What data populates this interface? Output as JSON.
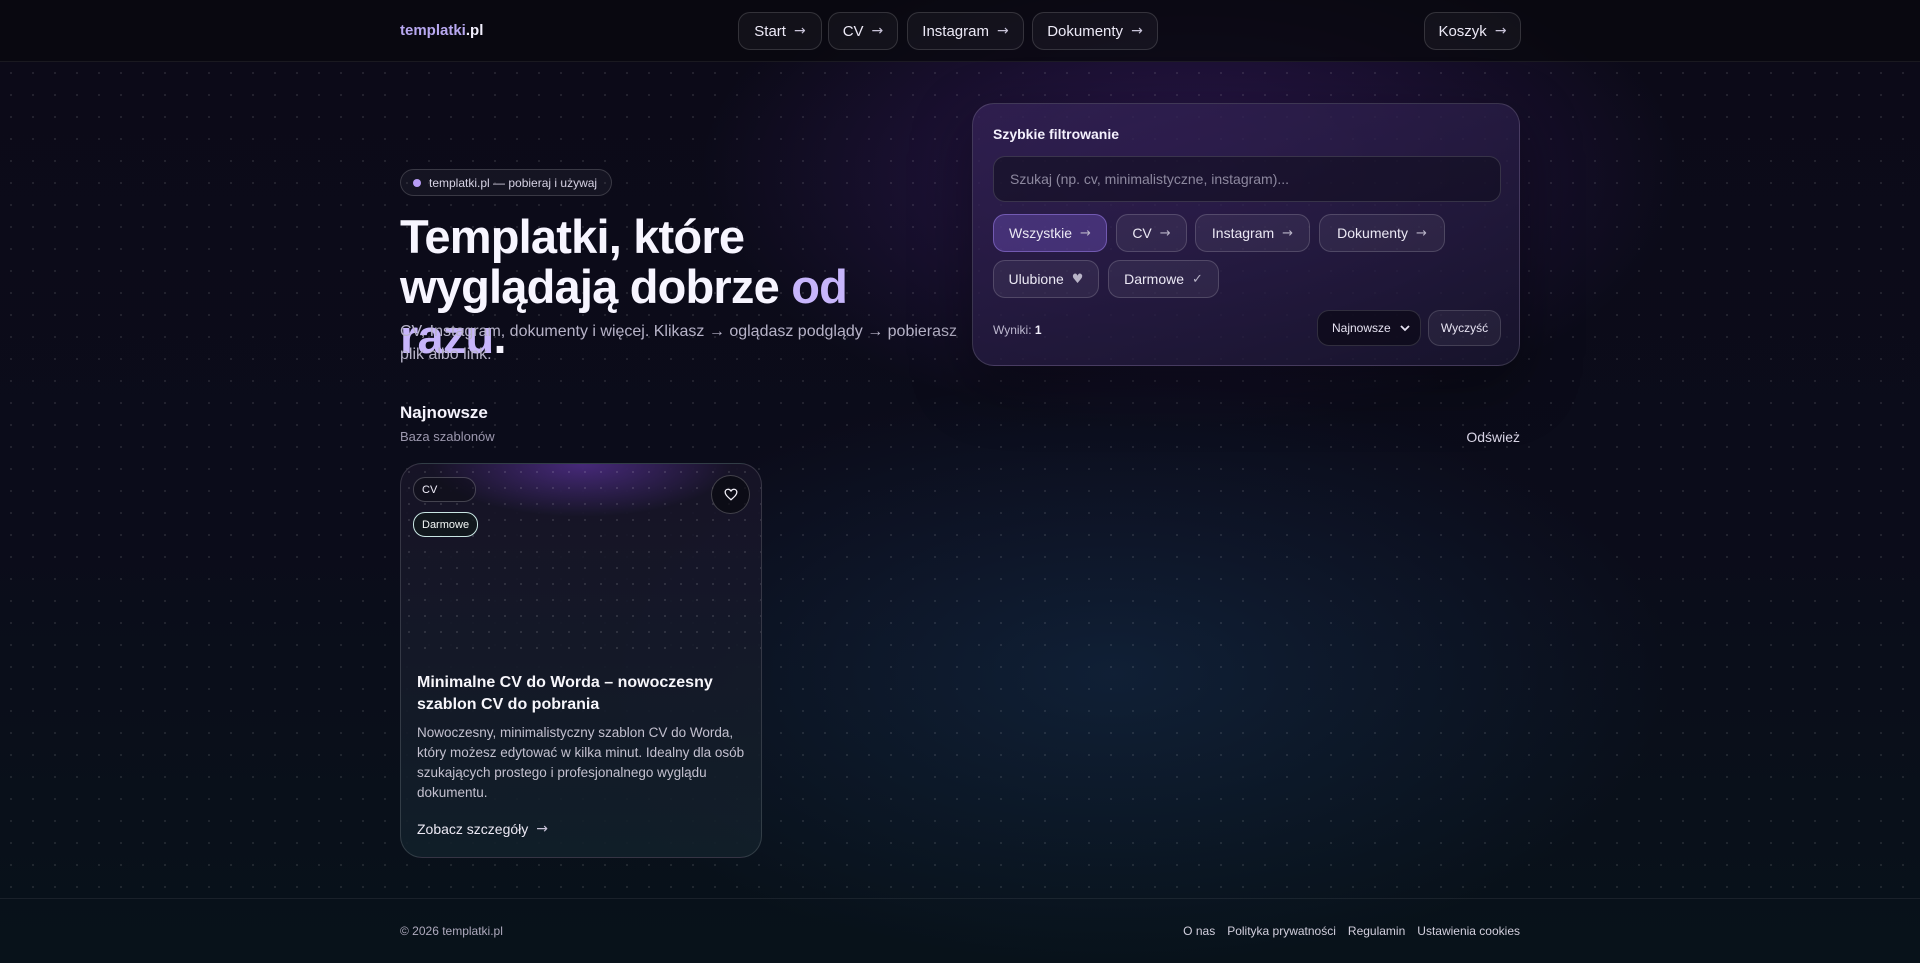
{
  "header": {
    "logo_main": "templatki",
    "logo_tld": ".pl",
    "nav": [
      {
        "label": "Start"
      },
      {
        "label": "CV"
      },
      {
        "label": "Instagram"
      },
      {
        "label": "Dokumenty"
      }
    ],
    "cart_label": "Koszyk",
    "arrow": "→"
  },
  "hero": {
    "pill": "templatki.pl — pobieraj i używaj",
    "title_line1": "Templatki, które",
    "title_line2_start": "wyglądają dobrze ",
    "title_accent": "od razu",
    "title_end": ".",
    "subtitle": "CV, Instagram, dokumenty i więcej. Klikasz → oglądasz podglądy → pobierasz plik albo link."
  },
  "filter": {
    "title": "Szybkie filtrowanie",
    "search_placeholder": "Szukaj (np. cv, minimalistyczne, instagram)...",
    "chips": [
      {
        "label": "Wszystkie",
        "symbol": "→",
        "active": true
      },
      {
        "label": "CV",
        "symbol": "→"
      },
      {
        "label": "Instagram",
        "symbol": "→"
      },
      {
        "label": "Dokumenty",
        "symbol": "→"
      },
      {
        "label": "Ulubione",
        "symbol": "♥"
      },
      {
        "label": "Darmowe",
        "symbol": "✓"
      }
    ],
    "results_label": "Wyniki:",
    "results_count": "1",
    "sort_selected": "Najnowsze",
    "clear_label": "Wyczyść"
  },
  "section": {
    "title": "Najnowsze",
    "subtitle": "Baza szablonów",
    "refresh_label": "Odśwież"
  },
  "card": {
    "tag_category": "CV",
    "tag_price": "Darmowe",
    "title": "Minimalne CV do Worda – nowoczesny szablon CV do pobrania",
    "description": "Nowoczesny, minimalistyczny szablon CV do Worda, który możesz edytować w kilka minut. Idealny dla osób szukających prostego i profesjonalnego wyglądu dokumentu.",
    "link_label": "Zobacz szczegóły",
    "link_arrow": "→"
  },
  "footer": {
    "copyright": "© 2026 templatki.pl",
    "links": [
      "O nas",
      "Polityka prywatności",
      "Regulamin",
      "Ustawienia cookies"
    ]
  },
  "colors": {
    "accent": "#c7b5fb",
    "background": "#0c0a18",
    "free_tag_border": "#c9e7e4"
  }
}
